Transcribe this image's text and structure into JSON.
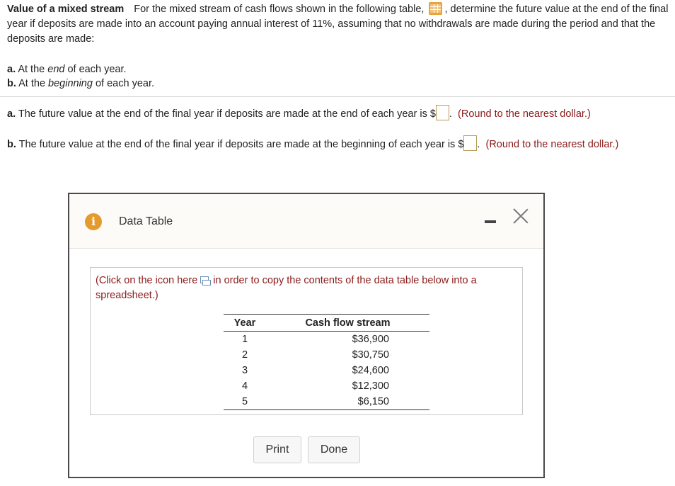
{
  "question": {
    "title": "Value of a mixed stream",
    "intro_1": "For the mixed stream of cash flows shown in the following table,",
    "intro_2": ", determine the future value at the end of the final year if deposits are made into an account paying annual interest of 11%, assuming that no withdrawals are made during the period and that the deposits are made:",
    "part_a_letter": "a.",
    "part_a_pre": "At the",
    "part_a_em": "end",
    "part_a_post": "of each year.",
    "part_b_letter": "b.",
    "part_b_pre": "At the",
    "part_b_em": "beginning",
    "part_b_post": "of each year."
  },
  "answers": {
    "a_letter": "a.",
    "a_text": "The future value at the end of the final year if deposits are made at the end of each year is $",
    "a_dot": ".",
    "a_hint": "(Round to the nearest dollar.)",
    "b_letter": "b.",
    "b_text": "The future value at the end of the final year if deposits are made at the beginning of each year is $",
    "b_dot": ".",
    "b_hint": "(Round to the nearest dollar.)"
  },
  "modal": {
    "info_glyph": "i",
    "title": "Data Table",
    "note_pre": "(Click on the icon here",
    "note_post": "in order to copy the contents of the data table below into a spreadsheet.)",
    "table": {
      "headers": [
        "Year",
        "Cash flow stream"
      ],
      "rows": [
        [
          "1",
          "$36,900"
        ],
        [
          "2",
          "$30,750"
        ],
        [
          "3",
          "$24,600"
        ],
        [
          "4",
          "$12,300"
        ],
        [
          "5",
          "$6,150"
        ]
      ]
    },
    "print_label": "Print",
    "done_label": "Done"
  },
  "colors": {
    "hint_red": "#8b1a1a",
    "icon_orange": "#e39b2e",
    "modal_border": "#4a4a4a"
  }
}
